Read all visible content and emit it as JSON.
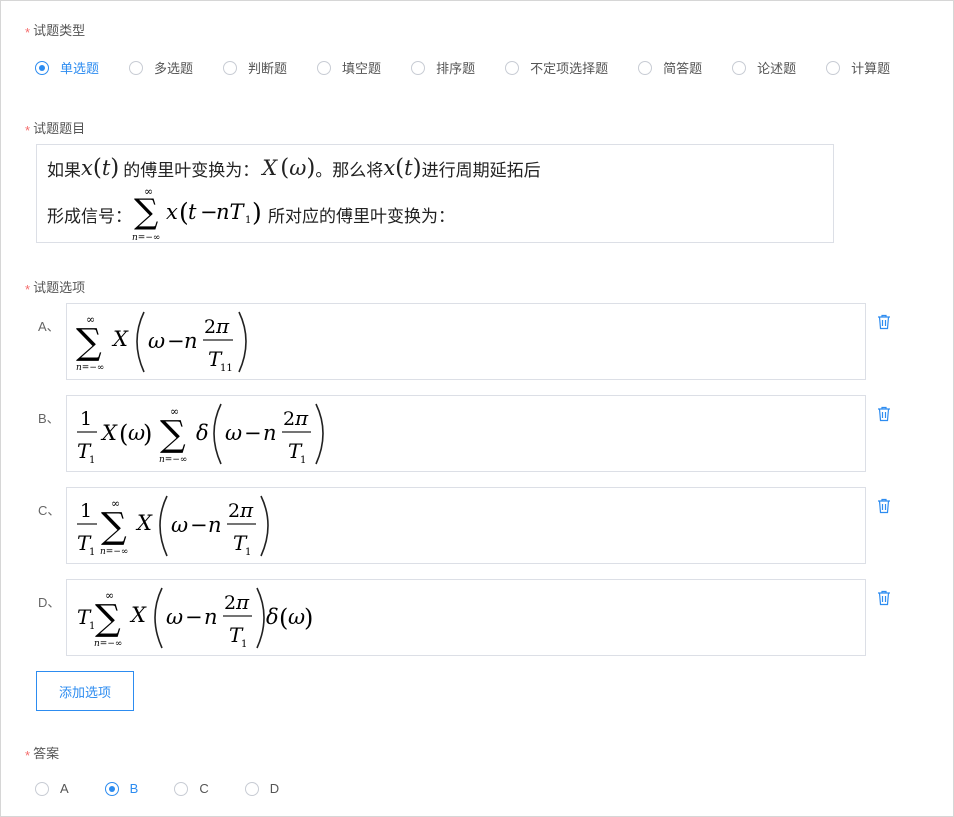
{
  "required_mark": "*",
  "question_type": {
    "label": "试题类型",
    "options": [
      "单选题",
      "多选题",
      "判断题",
      "填空题",
      "排序题",
      "不定项选择题",
      "简答题",
      "论述题",
      "计算题"
    ],
    "selected": "单选题"
  },
  "question_stem": {
    "label": "试题题目",
    "text_1": "如果",
    "text_2": "的傅里叶变换为：",
    "text_3": "。那么将",
    "text_4": "进行周期延拓后",
    "text_5": "形成信号：",
    "text_6": "所对应的傅里叶变换为："
  },
  "question_options": {
    "label": "试题选项",
    "items": [
      {
        "letter": "A、",
        "formula": "Σ_{n=-∞}^{∞} X(ω − n·2π/T11)"
      },
      {
        "letter": "B、",
        "formula": "(1/T1) X(ω) Σ_{n=-∞}^{∞} δ(ω − n·2π/T1)"
      },
      {
        "letter": "C、",
        "formula": "(1/T1) Σ_{n=-∞}^{∞} X(ω − n·2π/T1)"
      },
      {
        "letter": "D、",
        "formula": "T1 Σ_{n=-∞}^{∞} X(ω − n·2π/T1) δ(ω)"
      }
    ],
    "delete_icon": "trash-icon",
    "add_button": "添加选项"
  },
  "answer": {
    "label": "答案",
    "options": [
      "A",
      "B",
      "C",
      "D"
    ],
    "selected": "B"
  },
  "colors": {
    "accent": "#2d8cf0",
    "required": "#f56c6c",
    "border": "#dcdfe6"
  }
}
